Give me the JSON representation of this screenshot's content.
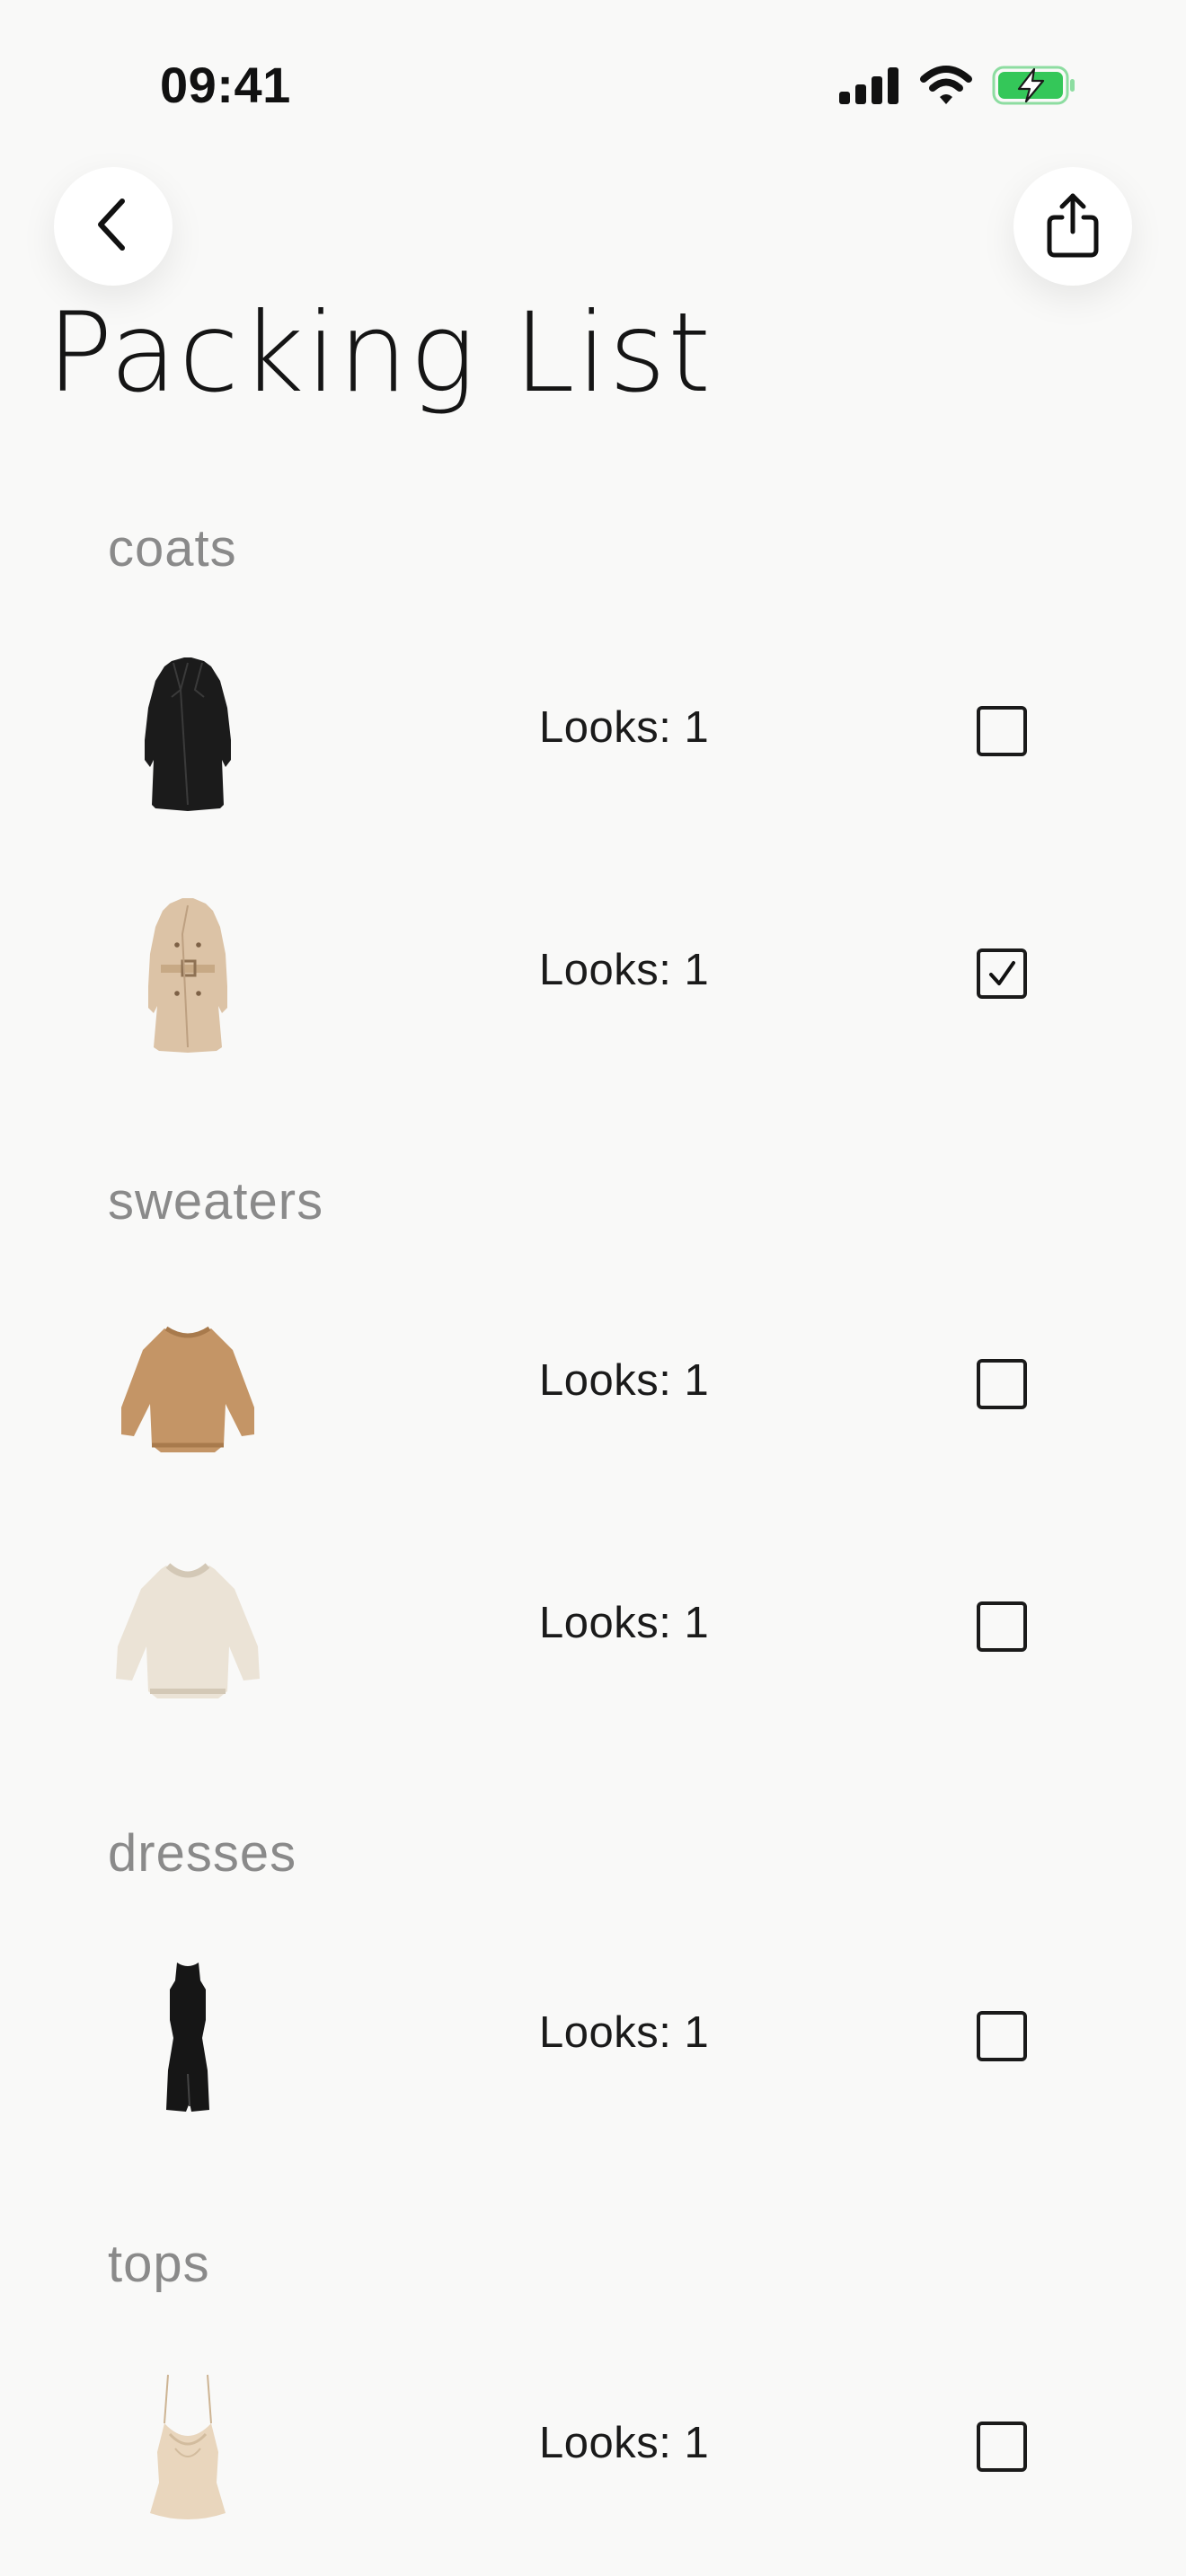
{
  "status_bar": {
    "time": "09:41",
    "icons": [
      "cellular-signal-icon",
      "wifi-icon",
      "battery-charging-icon"
    ],
    "battery_color": "#34c759"
  },
  "header": {
    "title": "Packing List",
    "back_icon": "chevron-left-icon",
    "share_icon": "share-icon"
  },
  "sections": [
    {
      "heading": "coats",
      "items": [
        {
          "image": "black-coat",
          "looks_label": "Looks: 1",
          "checked": false
        },
        {
          "image": "beige-trench-coat",
          "looks_label": "Looks: 1",
          "checked": true
        }
      ]
    },
    {
      "heading": "sweaters",
      "items": [
        {
          "image": "camel-sweater",
          "looks_label": "Looks: 1",
          "checked": false
        },
        {
          "image": "cream-knit-sweater",
          "looks_label": "Looks: 1",
          "checked": false
        }
      ]
    },
    {
      "heading": "dresses",
      "items": [
        {
          "image": "black-dress",
          "looks_label": "Looks: 1",
          "checked": false
        }
      ]
    },
    {
      "heading": "tops",
      "items": [
        {
          "image": "champagne-cami-top",
          "looks_label": "Looks: 1",
          "checked": false
        }
      ]
    }
  ]
}
